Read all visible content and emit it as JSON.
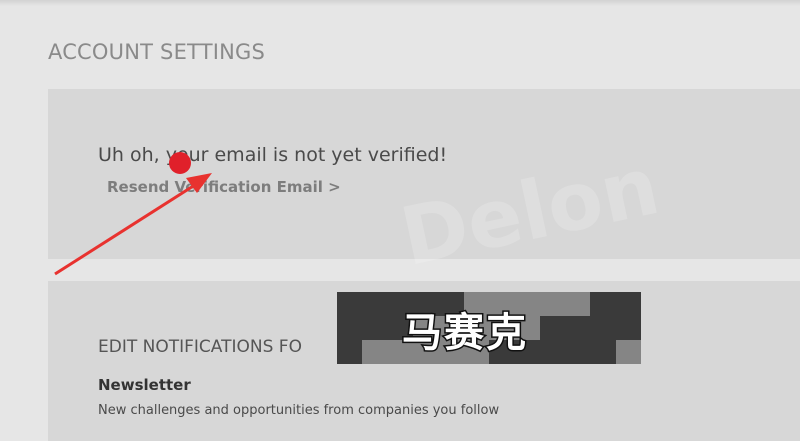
{
  "page": {
    "title": "ACCOUNT SETTINGS"
  },
  "verification": {
    "message": "Uh oh, your email is not yet verified!",
    "resend_link": "Resend Verification Email >"
  },
  "notifications": {
    "heading": "EDIT NOTIFICATIONS FO",
    "newsletter_label": "Newsletter",
    "newsletter_description": "New challenges and opportunities from companies you follow"
  },
  "overlay": {
    "watermark": "Delon",
    "mosaic_caption": "马赛克",
    "marker_color": "#e0202a",
    "arrow_color": "#e8322f"
  }
}
